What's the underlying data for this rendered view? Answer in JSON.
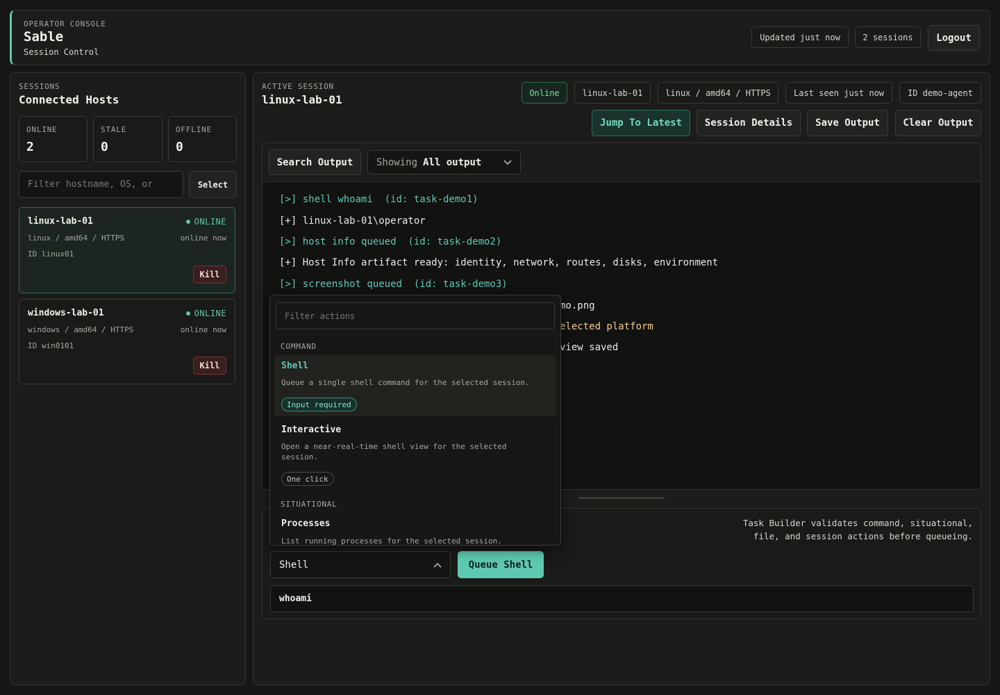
{
  "header": {
    "eyebrow": "OPERATOR CONSOLE",
    "brand": "Sable",
    "subtitle": "Session Control",
    "updated": "Updated just now",
    "sessions": "2 sessions",
    "logout": "Logout"
  },
  "sidebar": {
    "eyebrow": "SESSIONS",
    "title": "Connected Hosts",
    "stats": [
      {
        "label": "ONLINE",
        "value": "2"
      },
      {
        "label": "STALE",
        "value": "0"
      },
      {
        "label": "OFFLINE",
        "value": "0"
      }
    ],
    "filter_placeholder": "Filter hostname, OS, or",
    "select_label": "Select",
    "hosts": [
      {
        "name": "linux-lab-01",
        "status": "ONLINE",
        "platform": "linux / amd64 / HTTPS",
        "seen": "online now",
        "id": "ID linux01",
        "kill": "Kill"
      },
      {
        "name": "windows-lab-01",
        "status": "ONLINE",
        "platform": "windows / amd64 / HTTPS",
        "seen": "online now",
        "id": "ID win0101",
        "kill": "Kill"
      }
    ]
  },
  "main": {
    "eyebrow": "ACTIVE SESSION",
    "title": "linux-lab-01",
    "chips": {
      "status": "Online",
      "host": "linux-lab-01",
      "platform": "linux / amd64 / HTTPS",
      "last_seen": "Last seen just now",
      "id": "ID demo-agent"
    },
    "actions": {
      "jump": "Jump To Latest",
      "details": "Session Details",
      "save": "Save Output",
      "clear": "Clear Output"
    },
    "output_toolbar": {
      "search": "Search Output",
      "showing_prefix": "Showing",
      "showing_value": "All output"
    },
    "log": [
      "[>] shell whoami  (id: task-demo1)",
      "[+] linux-lab-01\\operator",
      "[>] host info queued  (id: task-demo2)",
      "[+] Host Info artifact ready: identity, network, routes, disks, environment",
      "[>] screenshot queued  (id: task-demo3)",
      "mo.png",
      "elected platform",
      "view saved"
    ],
    "builder": {
      "note": "Task Builder validates command, situational, file, and session actions before queueing.",
      "action_selected": "Shell",
      "queue_label": "Queue Shell",
      "command_value": "whoami"
    }
  },
  "menu": {
    "filter_placeholder": "Filter actions",
    "groups": [
      {
        "label": "COMMAND",
        "items": [
          {
            "title": "Shell",
            "desc": "Queue a single shell command for the selected session.",
            "tag": "Input required"
          },
          {
            "title": "Interactive",
            "desc": "Open a near-real-time shell view for the selected session.",
            "tag": "One click"
          }
        ]
      },
      {
        "label": "SITUATIONAL",
        "items": [
          {
            "title": "Processes",
            "desc": "List running processes for the selected session."
          }
        ]
      }
    ]
  },
  "colors": {
    "accent": "#5ec9b0",
    "online": "#5ec9a0",
    "log_cyan": "#5ec9b8",
    "log_amber": "#f2c98a",
    "kill": "#7a3535"
  }
}
